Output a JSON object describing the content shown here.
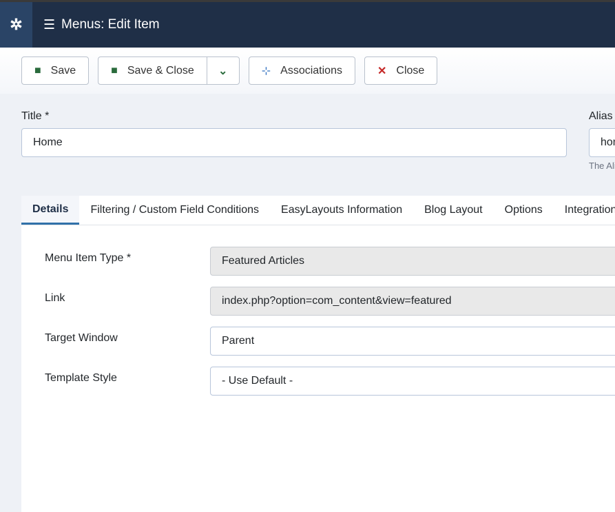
{
  "header": {
    "title": "Menus: Edit Item",
    "logo_icon": "joomla-icon",
    "title_icon": "list-icon"
  },
  "toolbar": {
    "save": "Save",
    "save_close": "Save & Close",
    "associations": "Associations",
    "close": "Close"
  },
  "form": {
    "title_label": "Title *",
    "title_value": "Home",
    "alias_label": "Alias",
    "alias_value": "home",
    "alias_help": "The Alias"
  },
  "tabs": [
    "Details",
    "Filtering / Custom Field Conditions",
    "EasyLayouts Information",
    "Blog Layout",
    "Options",
    "Integration"
  ],
  "details": {
    "menu_item_type_label": "Menu Item Type *",
    "menu_item_type_value": "Featured Articles",
    "link_label": "Link",
    "link_value": "index.php?option=com_content&view=featured",
    "target_label": "Target Window",
    "target_value": "Parent",
    "template_label": "Template Style",
    "template_value": "- Use Default -"
  },
  "colors": {
    "header": "#1f2f47",
    "save_icon": "#2a6b3c",
    "assoc_icon": "#2f6fbf",
    "close_icon": "#c52827",
    "tab_active": "#3071a9"
  }
}
